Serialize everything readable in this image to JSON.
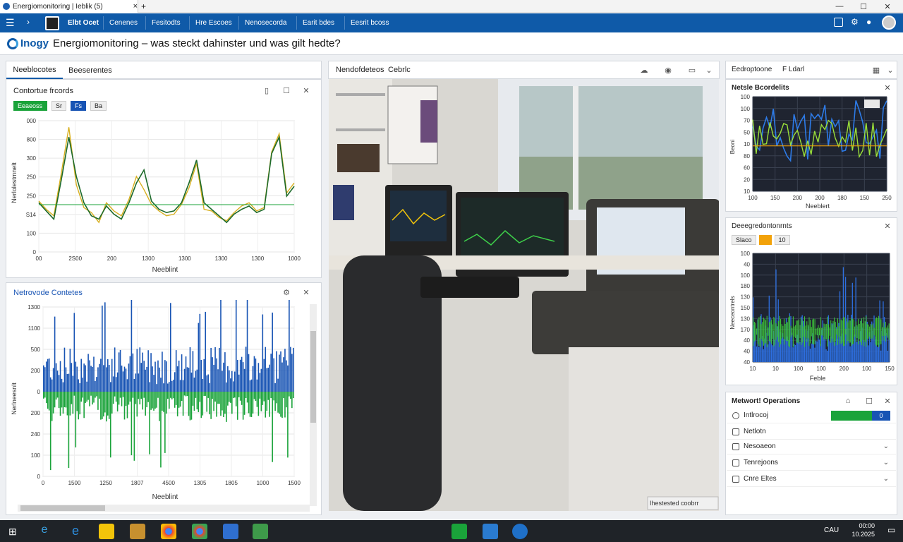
{
  "window": {
    "tab_title": "Energiomonitoring | Ieblik (5)",
    "new_tab": "+",
    "close_tab": "×"
  },
  "nav": {
    "items": [
      "Elbt Ocet",
      "Cenenes",
      "Fesitodts",
      "Hre Escoes",
      "Nenosecorda",
      "Earit bdes",
      "Eesrit bcoss"
    ]
  },
  "header": {
    "logo_text": "Inogy",
    "title": "Energiomonitoring – was steckt dahinster und was gilt hedte?"
  },
  "left_tabs": [
    "Neeblocotes",
    "Beeserentes"
  ],
  "chart1": {
    "title": "Contortue frcords",
    "chips": [
      "Eeaeoss",
      "Sr",
      "Fs",
      "Ba"
    ],
    "xlabel": "Neeblint",
    "ylabel": "Nerlolestmnelt"
  },
  "chart2": {
    "title": "Netrovode Contetes",
    "xlabel": "Neeblint",
    "ylabel": "Nerlneesnlt"
  },
  "center": {
    "tabs": [
      "Nendofdeteos",
      "Cebrlc"
    ],
    "caption": "Ihestested coobrr"
  },
  "right_tabs": [
    "Eedroptoone",
    "F Ldarl"
  ],
  "chart3": {
    "title": "Netsle Bcordelits",
    "xlabel": "Neeblert",
    "ylabel": "Beoni"
  },
  "chart4": {
    "title": "Deeegredontonrnts",
    "chips": [
      "Slaco",
      "",
      "10"
    ],
    "xlabel": "Feble",
    "ylabel": "Neeceontrels"
  },
  "netops": {
    "title": "Metwort! Operations",
    "items": [
      {
        "label": "Intlrocoj",
        "value": "0"
      },
      {
        "label": "Netlotn"
      },
      {
        "label": "Nesoaeon"
      },
      {
        "label": "Tenrejoons"
      },
      {
        "label": "Cnre Eltes"
      }
    ]
  },
  "taskbar": {
    "time": "00:00",
    "date": "10.2025",
    "lang": "CAU"
  },
  "colors": {
    "nav": "#0f5aa8",
    "green": "#1aa33a",
    "blue": "#1854b4",
    "orange": "#f2a20a",
    "yellow": "#d8b020"
  },
  "chart_data": [
    {
      "type": "line",
      "title": "Contortue frcords",
      "x_ticks": [
        "00",
        "2S00",
        "200",
        "1300",
        "1300",
        "1300",
        "1300",
        "1000"
      ],
      "y_ticks": [
        "000",
        "800",
        "300",
        "250",
        "250",
        "S14",
        "100",
        "0"
      ],
      "series": [
        {
          "values": [
            310,
            260,
            220,
            480,
            760,
            410,
            270,
            240,
            180,
            300,
            250,
            220,
            320,
            460,
            380,
            290,
            250,
            220,
            230,
            290,
            390,
            540,
            260,
            250,
            210,
            190,
            240,
            280,
            300,
            250,
            270,
            610,
            720,
            360,
            420
          ]
        },
        {
          "values": [
            300,
            250,
            200,
            440,
            700,
            460,
            300,
            220,
            200,
            280,
            230,
            200,
            300,
            420,
            500,
            310,
            260,
            240,
            250,
            300,
            420,
            560,
            300,
            260,
            220,
            180,
            230,
            260,
            280,
            240,
            260,
            600,
            700,
            340,
            400
          ]
        }
      ]
    },
    {
      "type": "bar",
      "title": "Netrovode Contetes",
      "x_ticks": [
        "0",
        "1500",
        "1250",
        "1807",
        "4500",
        "1305",
        "1805",
        "1000",
        "1500"
      ],
      "y_ticks": [
        "1300",
        "1100",
        "500",
        "200",
        "0",
        "200",
        "240",
        "100",
        "0"
      ]
    },
    {
      "type": "line",
      "title": "Netsle Bcordelits",
      "x_ticks": [
        "100",
        "150",
        "200",
        "200",
        "180",
        "150",
        "250"
      ],
      "y_ticks": [
        "100",
        "100",
        "70",
        "50",
        "10",
        "80",
        "60",
        "20",
        "10"
      ]
    },
    {
      "type": "bar",
      "title": "Deeegredontonrnts",
      "x_ticks": [
        "10",
        "10",
        "100",
        "100",
        "200",
        "100",
        "150"
      ],
      "y_ticks": [
        "100",
        "40",
        "100",
        "180",
        "130",
        "150",
        "130",
        "170",
        "40",
        "40",
        "40"
      ]
    }
  ]
}
